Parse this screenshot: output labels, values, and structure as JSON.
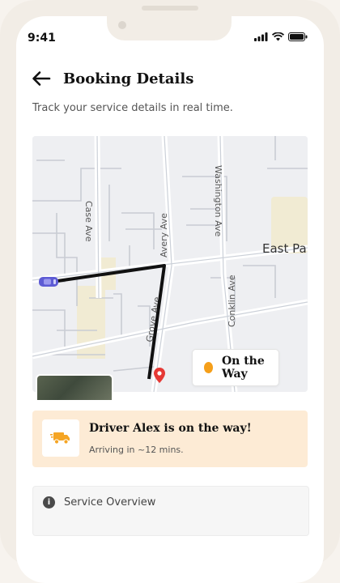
{
  "status_bar": {
    "time": "9:41"
  },
  "header": {
    "title": "Booking Details",
    "back_icon": "arrow-left-icon"
  },
  "subtitle": "Track your service details in real time.",
  "map": {
    "streets": [
      "Case Ave",
      "Avery Ave",
      "Washington Ave",
      "Conklin Ave",
      "Grove Ave"
    ],
    "area_label": "East Pa",
    "route_color": "#111111",
    "pin_color": "#e53935"
  },
  "status": {
    "label": "On the Way",
    "dot_color": "#f59f1a"
  },
  "driver": {
    "title": "Driver Alex is on the way!",
    "eta": "Arriving in ~12 mins.",
    "icon": "truck-icon",
    "accent": "#f5a524"
  },
  "overview": {
    "label": "Service Overview",
    "icon": "info-icon"
  }
}
